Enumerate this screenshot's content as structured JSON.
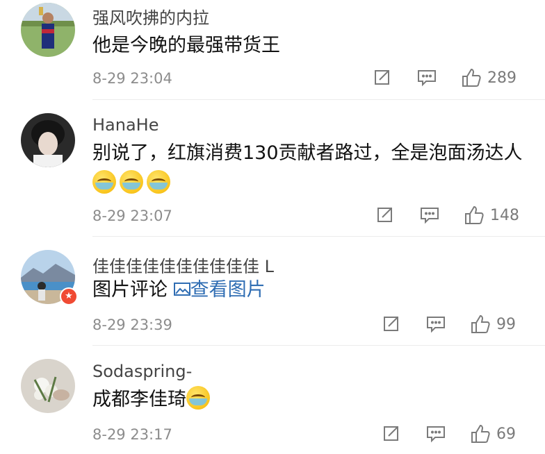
{
  "comments": [
    {
      "username": "强风吹拂的内拉",
      "text": "他是今晚的最强带货王",
      "time": "8-29 23:04",
      "likes": "289"
    },
    {
      "username": "HanaHe",
      "text": "别说了，红旗消费130贡献者路过，全是泡面汤达人",
      "emojis": [
        "laugh-cry-emoji",
        "laugh-cry-emoji",
        "laugh-cry-emoji"
      ],
      "time": "8-29 23:07",
      "likes": "148"
    },
    {
      "username": "佳佳佳佳佳佳佳佳佳佳 L",
      "text": "图片评论",
      "link": "查看图片",
      "time": "8-29 23:39",
      "likes": "99"
    },
    {
      "username": "Sodaspring-",
      "text": "成都李佳琦",
      "emojis": [
        "cry-emoji"
      ],
      "time": "8-29 23:17",
      "likes": "69"
    }
  ],
  "colors": {
    "link": "#2f6db3",
    "meta": "#8c8c8c",
    "badge": "#f04a33"
  },
  "icons": [
    "repost-icon",
    "comment-icon",
    "like-icon",
    "image-icon"
  ]
}
